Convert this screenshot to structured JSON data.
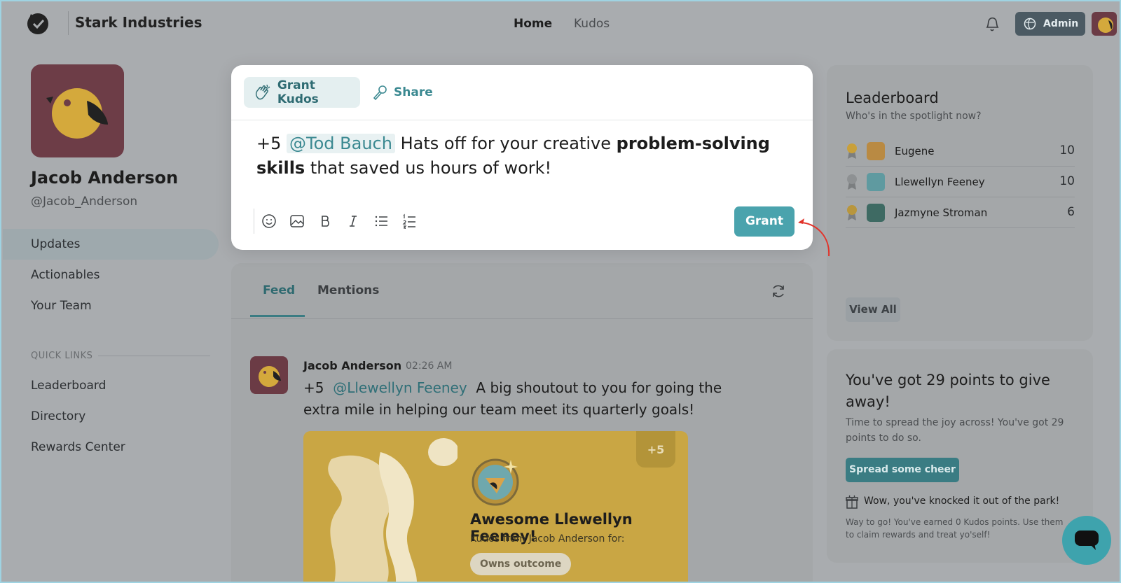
{
  "header": {
    "brand": "Stark Industries",
    "nav": [
      "Home",
      "Kudos"
    ],
    "admin_label": "Admin"
  },
  "profile": {
    "name": "Jacob Anderson",
    "handle": "@Jacob_Anderson"
  },
  "sidebar": {
    "items": [
      "Updates",
      "Actionables",
      "Your Team"
    ],
    "active_index": 0,
    "quick_links_label": "QUICK LINKS",
    "quick_links": [
      "Leaderboard",
      "Directory",
      "Rewards Center"
    ]
  },
  "composer": {
    "tab_grant": "Grant Kudos",
    "tab_share": "Share",
    "points": "+5",
    "mention": "@Tod Bauch",
    "text_before_bold": "Hats off for your creative",
    "bold_text": "problem-solving skills",
    "text_after_bold": "that saved us hours of work!",
    "grant_label": "Grant"
  },
  "feed": {
    "tabs": [
      "Feed",
      "Mentions"
    ],
    "post": {
      "author": "Jacob Anderson",
      "time": "02:26 AM",
      "points": "+5",
      "mention": "@Llewellyn Feeney",
      "text": "A big shoutout to you for going the extra mile in helping our team meet its quarterly goals!",
      "card": {
        "badge": "+5",
        "title": "Awesome Llewellyn Feeney!",
        "from": "Kudos from Jacob Anderson for:",
        "chip": "Owns outcome"
      }
    }
  },
  "leaderboard": {
    "title": "Leaderboard",
    "subtitle": "Who's in the spotlight now?",
    "rows": [
      {
        "name": "Eugene",
        "points": "10",
        "medal": "gold",
        "avatar_color": "#b98a43"
      },
      {
        "name": "Llewellyn Feeney",
        "points": "10",
        "medal": "silver",
        "avatar_color": "#5f9aa0"
      },
      {
        "name": "Jazmyne Stroman",
        "points": "6",
        "medal": "gold",
        "avatar_color": "#3e6a63"
      }
    ],
    "view_all": "View All"
  },
  "points_panel": {
    "title": "You've got 29 points to give away!",
    "subtitle": "Time to spread the joy across! You've got 29 points to do so.",
    "button": "Spread some cheer",
    "gift_title": "Wow, you've knocked it out of the park!",
    "gift_sub": "Way to go! You've earned 0 Kudos points. Use them to claim rewards and treat yo'self!"
  },
  "colors": {
    "accent": "#4aa3ad",
    "accent_dark": "#2f6c73",
    "avatar_bg": "#6d3d47",
    "bird": "#d4a93c"
  }
}
